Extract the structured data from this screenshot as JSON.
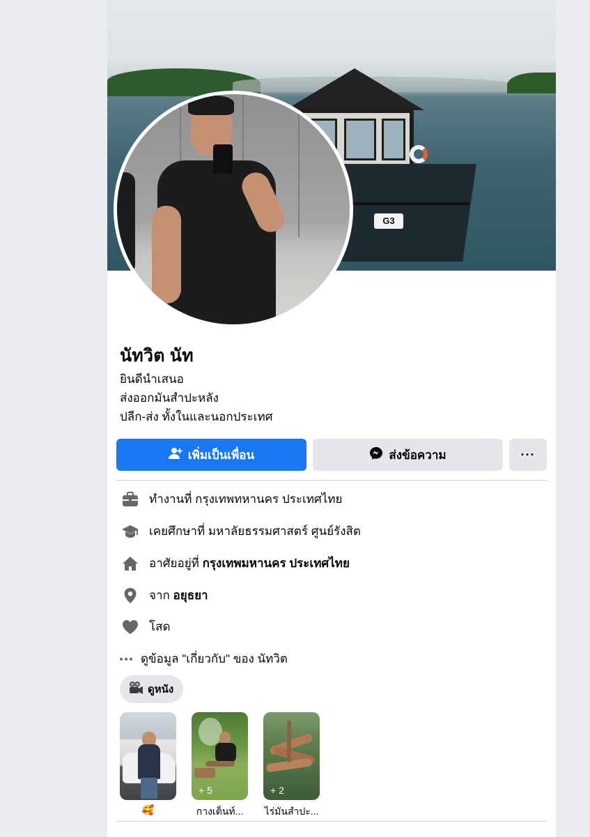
{
  "profile": {
    "name": "นัทวิต นัท",
    "bio": [
      "ยินดีนำเสนอ",
      "ส่งออกมันสำปะหลัง",
      "ปลีก-ส่ง ทั้งในและนอกประเทศ"
    ]
  },
  "cover": {
    "badge_text": "G3"
  },
  "actions": {
    "add_friend": "เพิ่มเป็นเพื่อน",
    "message": "ส่งข้อความ",
    "more": "···"
  },
  "intro": {
    "work": "ทำงานที่ กรุงเทพทหานคร ประเทศไทย",
    "education": "เคยศึกษาที่ มหาลัยธรรมศาสตร์ ศูนย์รังสิต",
    "lives_prefix": "อาศัยอยู่ที่ ",
    "lives_value": "กรุงเทพมหานคร ประเทศไทย",
    "from_prefix": "จาก ",
    "from_value": "อยุธยา",
    "relationship": "โสด",
    "see_about": "ดูข้อมูล \"เกี่ยวกับ\" ของ นัทวิต"
  },
  "hobby_chip": {
    "label": "ดูหนัง",
    "icon": "movie-camera-icon"
  },
  "highlights": [
    {
      "caption": "🥰",
      "count": ""
    },
    {
      "caption": "กางเต็นท์...",
      "count": "+ 5"
    },
    {
      "caption": "ไร่มันสำปะ...",
      "count": "+ 2"
    }
  ],
  "colors": {
    "primary": "#1877f2",
    "secondary_button": "#e4e6eb",
    "icon_gray": "#65676b",
    "background": "#e9ebee"
  }
}
